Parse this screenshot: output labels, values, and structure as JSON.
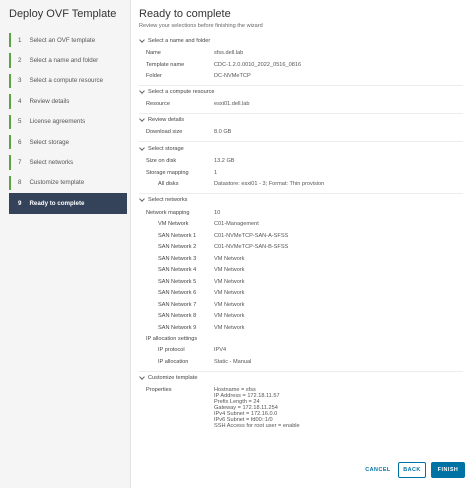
{
  "wizard": {
    "title": "Deploy OVF Template",
    "steps": [
      {
        "num": "1",
        "label": "Select an OVF template"
      },
      {
        "num": "2",
        "label": "Select a name and folder"
      },
      {
        "num": "3",
        "label": "Select a compute resource"
      },
      {
        "num": "4",
        "label": "Review details"
      },
      {
        "num": "5",
        "label": "License agreements"
      },
      {
        "num": "6",
        "label": "Select storage"
      },
      {
        "num": "7",
        "label": "Select networks"
      },
      {
        "num": "8",
        "label": "Customize template"
      },
      {
        "num": "9",
        "label": "Ready to complete"
      }
    ],
    "current_step": 9,
    "completed_color": "#5ea243",
    "current_color": "#34435a"
  },
  "page": {
    "title": "Ready to complete",
    "subtitle": "Review your selections before finishing the wizard"
  },
  "sections": {
    "name_folder": {
      "title": "Select a name and folder",
      "name_label": "Name",
      "name_value": "sfss.dell.lab",
      "template_label": "Template name",
      "template_value": "CDC-1.2.0.0010_2022_0516_0816",
      "folder_label": "Folder",
      "folder_value": "DC-NVMeTCP"
    },
    "compute": {
      "title": "Select a compute resource",
      "resource_label": "Resource",
      "resource_value": "esxi01.dell.lab"
    },
    "review": {
      "title": "Review details",
      "download_label": "Download size",
      "download_value": "8.0 GB"
    },
    "storage": {
      "title": "Select storage",
      "disk_label": "Size on disk",
      "disk_value": "13.2 GB",
      "mapping_label": "Storage mapping",
      "mapping_value": "1",
      "alldisks_label": "All disks",
      "alldisks_value": "Datastore: esxi01 - 3; Format: Thin provision"
    },
    "networks": {
      "title": "Select networks",
      "mapping_label": "Network mapping",
      "mapping_value": "10",
      "rows": [
        {
          "label": "VM Network",
          "value": "C01-Management"
        },
        {
          "label": "SAN Network 1",
          "value": "C01-NVMeTCP-SAN-A-SFSS"
        },
        {
          "label": "SAN Network 2",
          "value": "C01-NVMeTCP-SAN-B-SFSS"
        },
        {
          "label": "SAN Network 3",
          "value": "VM Network"
        },
        {
          "label": "SAN Network 4",
          "value": "VM Network"
        },
        {
          "label": "SAN Network 5",
          "value": "VM Network"
        },
        {
          "label": "SAN Network 6",
          "value": "VM Network"
        },
        {
          "label": "SAN Network 7",
          "value": "VM Network"
        },
        {
          "label": "SAN Network 8",
          "value": "VM Network"
        },
        {
          "label": "SAN Network 9",
          "value": "VM Network"
        }
      ],
      "ipalloc_label": "IP allocation settings",
      "ipproto_label": "IP protocol",
      "ipproto_value": "IPV4",
      "ipallocation_label": "IP allocation",
      "ipallocation_value": "Static - Manual"
    },
    "customize": {
      "title": "Customize template",
      "properties_label": "Properties",
      "properties_value": "Hostname = sfss\nIP Address = 172.18.11.57\nPrefix Length = 24\nGateway = 172.18.11.254\nIPv4 Subnet = 172.16.0.0\nIPv6 Subnet = fd00::1/0\nSSH Access for root user = enable"
    }
  },
  "footer": {
    "cancel_label": "CANCEL",
    "back_label": "BACK",
    "finish_label": "FINISH"
  }
}
